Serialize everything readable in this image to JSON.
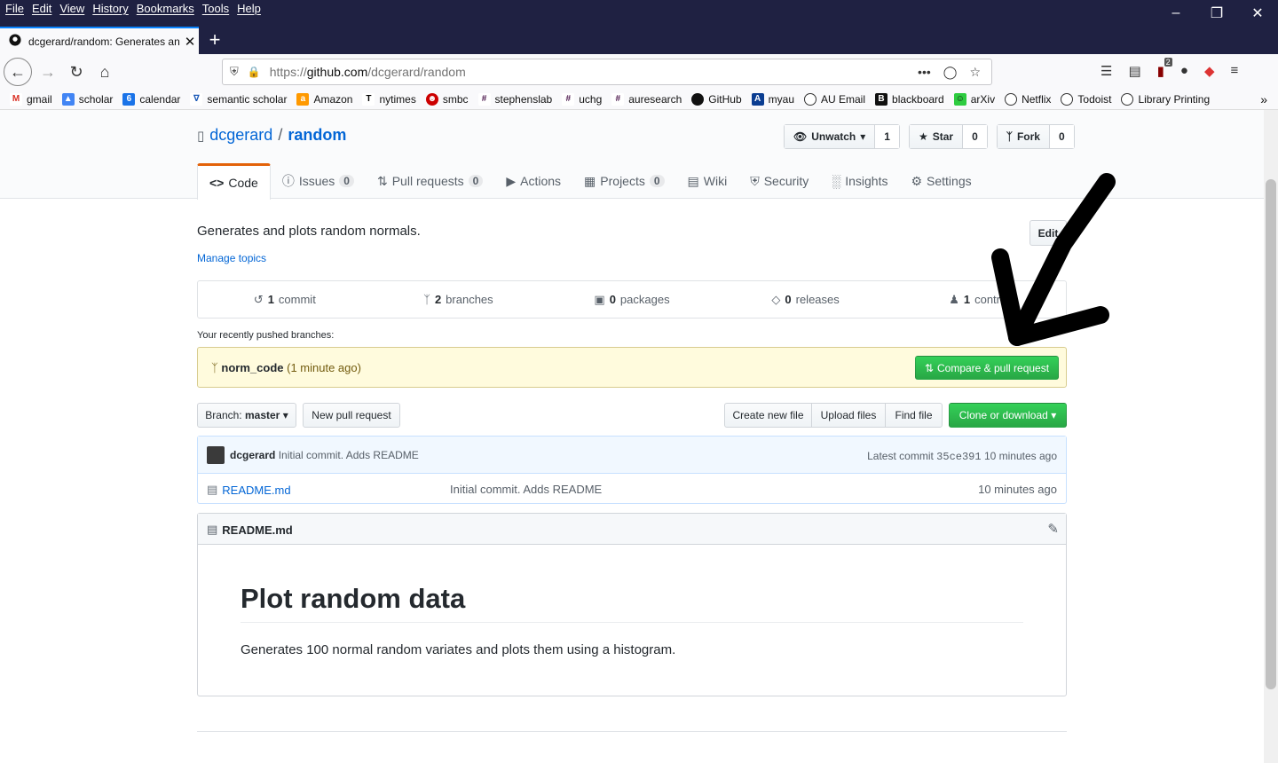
{
  "menubar": {
    "items": [
      "File",
      "Edit",
      "View",
      "History",
      "Bookmarks",
      "Tools",
      "Help"
    ]
  },
  "tab": {
    "title": "dcgerard/random: Generates an"
  },
  "url": {
    "prefix": "https://",
    "host": "github.com",
    "path": "/dcgerard/random"
  },
  "toolbar": {
    "badge_count": "2"
  },
  "bookmarks": [
    "gmail",
    "scholar",
    "calendar",
    "semantic scholar",
    "Amazon",
    "nytimes",
    "smbc",
    "stephenslab",
    "uchg",
    "auresearch",
    "GitHub",
    "myau",
    "AU Email",
    "blackboard",
    "arXiv",
    "Netflix",
    "Todoist",
    "Library Printing"
  ],
  "calendar_day": "6",
  "repo": {
    "owner": "dcgerard",
    "slash": "/",
    "name": "random",
    "unwatch_label": "Unwatch",
    "unwatch_count": "1",
    "star_label": "Star",
    "star_count": "0",
    "fork_label": "Fork",
    "fork_count": "0"
  },
  "nav": {
    "code": "Code",
    "issues": "Issues",
    "issues_count": "0",
    "pulls": "Pull requests",
    "pulls_count": "0",
    "actions": "Actions",
    "projects": "Projects",
    "projects_count": "0",
    "wiki": "Wiki",
    "security": "Security",
    "insights": "Insights",
    "settings": "Settings"
  },
  "about": {
    "description": "Generates and plots random normals.",
    "manage_topics": "Manage topics",
    "edit": "Edit"
  },
  "summary": {
    "commits_n": "1",
    "commits_label": "commit",
    "branches_n": "2",
    "branches_label": "branches",
    "packages_n": "0",
    "packages_label": "packages",
    "releases_n": "0",
    "releases_label": "releases",
    "contrib_n": "1",
    "contrib_label": "contrib"
  },
  "recent": {
    "label": "Your recently pushed branches:",
    "branch": "norm_code",
    "time": "(1 minute ago)",
    "compare": "Compare & pull request"
  },
  "filebar": {
    "branch_prefix": "Branch:",
    "branch_name": "master",
    "new_pr": "New pull request",
    "create_file": "Create new file",
    "upload": "Upload files",
    "find": "Find file",
    "clone": "Clone or download"
  },
  "commit": {
    "author": "dcgerard",
    "message": "Initial commit. Adds README",
    "latest_prefix": "Latest commit",
    "sha": "35ce391",
    "age": "10 minutes ago"
  },
  "files": [
    {
      "name": "README.md",
      "message": "Initial commit. Adds README",
      "age": "10 minutes ago"
    }
  ],
  "readme": {
    "header": "README.md",
    "heading": "Plot random data",
    "body": "Generates 100 normal random variates and plots them using a histogram."
  }
}
